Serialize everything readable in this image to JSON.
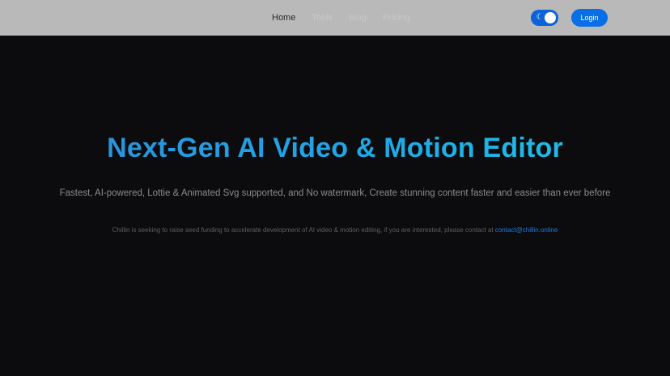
{
  "nav": {
    "links": [
      {
        "label": "Home",
        "active": true
      },
      {
        "label": "Tools",
        "active": false
      },
      {
        "label": "Blog",
        "active": false
      },
      {
        "label": "Pricing",
        "active": false
      }
    ],
    "theme_toggle_icon": "moon-icon",
    "login_label": "Login"
  },
  "hero": {
    "title": "Next-Gen AI Video & Motion Editor",
    "subtitle": "Fastest, AI-powered, Lottie & Animated Svg supported, and No watermark, Create stunning content faster and easier than ever before",
    "note_text": "Chillin is seeking to raise seed funding to accelerate development of AI video & motion editing, if you are interested, please contact at ",
    "contact_email": "contact@chillin.online"
  },
  "colors": {
    "navbar_bg": "#b9b9b9",
    "page_bg": "#0c0c0e",
    "accent": "#0a6ee6",
    "title_gradient_start": "#2e8bd8",
    "title_gradient_end": "#22c4e8"
  }
}
